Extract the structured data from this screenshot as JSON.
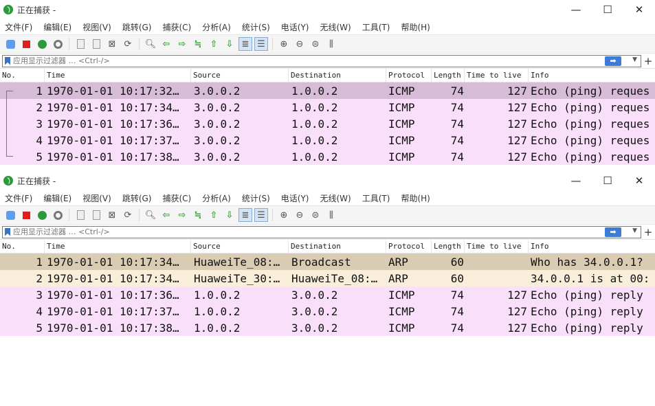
{
  "colors": {
    "icmp_row": "#f9dffa",
    "icmp_selected": "#d6bcd7",
    "arp_row": "#f8eed9",
    "arp_selected": "#d9ccb2",
    "filter_apply": "#3c7bd6"
  },
  "windows": [
    {
      "title": "正在捕获 -",
      "controls": {
        "minimize": "—",
        "maximize": "☐",
        "close": "✕"
      },
      "menu": [
        "文件(F)",
        "编辑(E)",
        "视图(V)",
        "跳转(G)",
        "捕获(C)",
        "分析(A)",
        "统计(S)",
        "电话(Y)",
        "无线(W)",
        "工具(T)",
        "帮助(H)"
      ],
      "filter": {
        "placeholder": "应用显示过滤器 … <Ctrl-/>",
        "apply_icon": "arrow-right-icon"
      },
      "columns": [
        "No.",
        "Time",
        "Source",
        "Destination",
        "Protocol",
        "Length",
        "Time to live",
        "Info"
      ],
      "packets": [
        {
          "no": "1",
          "time": "1970-01-01 10:17:32…",
          "src": "3.0.0.2",
          "dst": "1.0.0.2",
          "proto": "ICMP",
          "len": "74",
          "ttl": "127",
          "info": "Echo (ping) reques",
          "selected": true,
          "kind": "icmp"
        },
        {
          "no": "2",
          "time": "1970-01-01 10:17:34…",
          "src": "3.0.0.2",
          "dst": "1.0.0.2",
          "proto": "ICMP",
          "len": "74",
          "ttl": "127",
          "info": "Echo (ping) reques",
          "selected": false,
          "kind": "icmp"
        },
        {
          "no": "3",
          "time": "1970-01-01 10:17:36…",
          "src": "3.0.0.2",
          "dst": "1.0.0.2",
          "proto": "ICMP",
          "len": "74",
          "ttl": "127",
          "info": "Echo (ping) reques",
          "selected": false,
          "kind": "icmp"
        },
        {
          "no": "4",
          "time": "1970-01-01 10:17:37…",
          "src": "3.0.0.2",
          "dst": "1.0.0.2",
          "proto": "ICMP",
          "len": "74",
          "ttl": "127",
          "info": "Echo (ping) reques",
          "selected": false,
          "kind": "icmp"
        },
        {
          "no": "5",
          "time": "1970-01-01 10:17:38…",
          "src": "3.0.0.2",
          "dst": "1.0.0.2",
          "proto": "ICMP",
          "len": "74",
          "ttl": "127",
          "info": "Echo (ping) reques",
          "selected": false,
          "kind": "icmp"
        }
      ]
    },
    {
      "title": "正在捕获 -",
      "controls": {
        "minimize": "—",
        "maximize": "☐",
        "close": "✕"
      },
      "menu": [
        "文件(F)",
        "编辑(E)",
        "视图(V)",
        "跳转(G)",
        "捕获(C)",
        "分析(A)",
        "统计(S)",
        "电话(Y)",
        "无线(W)",
        "工具(T)",
        "帮助(H)"
      ],
      "filter": {
        "placeholder": "应用显示过滤器 … <Ctrl-/>",
        "apply_icon": "arrow-right-icon"
      },
      "columns": [
        "No.",
        "Time",
        "Source",
        "Destination",
        "Protocol",
        "Length",
        "Time to live",
        "Info"
      ],
      "packets": [
        {
          "no": "1",
          "time": "1970-01-01 10:17:34…",
          "src": "HuaweiTe_08:…",
          "dst": "Broadcast",
          "proto": "ARP",
          "len": "60",
          "ttl": "",
          "info": "Who has 34.0.0.1?",
          "selected": true,
          "kind": "arp"
        },
        {
          "no": "2",
          "time": "1970-01-01 10:17:34…",
          "src": "HuaweiTe_30:…",
          "dst": "HuaweiTe_08:…",
          "proto": "ARP",
          "len": "60",
          "ttl": "",
          "info": "34.0.0.1 is at 00:",
          "selected": false,
          "kind": "arp"
        },
        {
          "no": "3",
          "time": "1970-01-01 10:17:36…",
          "src": "1.0.0.2",
          "dst": "3.0.0.2",
          "proto": "ICMP",
          "len": "74",
          "ttl": "127",
          "info": "Echo (ping) reply",
          "selected": false,
          "kind": "icmp"
        },
        {
          "no": "4",
          "time": "1970-01-01 10:17:37…",
          "src": "1.0.0.2",
          "dst": "3.0.0.2",
          "proto": "ICMP",
          "len": "74",
          "ttl": "127",
          "info": "Echo (ping) reply",
          "selected": false,
          "kind": "icmp"
        },
        {
          "no": "5",
          "time": "1970-01-01 10:17:38…",
          "src": "1.0.0.2",
          "dst": "3.0.0.2",
          "proto": "ICMP",
          "len": "74",
          "ttl": "127",
          "info": "Echo (ping) reply",
          "selected": false,
          "kind": "icmp"
        }
      ]
    }
  ]
}
